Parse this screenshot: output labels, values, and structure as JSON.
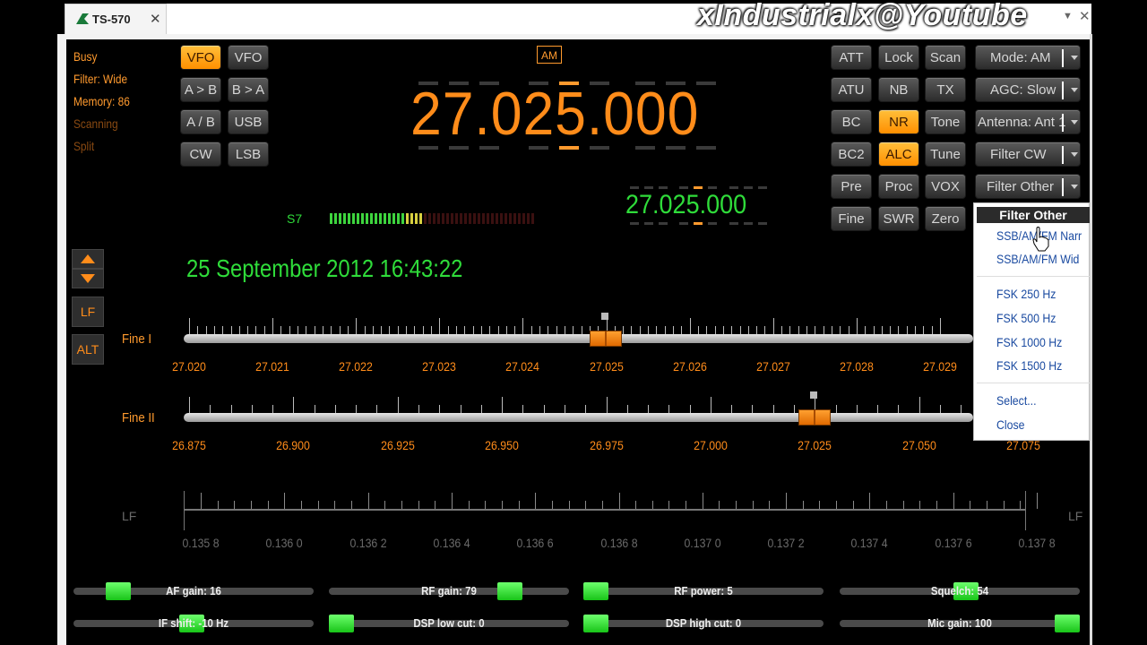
{
  "tab": {
    "title": "TS-570",
    "close": "✕"
  },
  "watermark": "xIndustrialx@Youtube",
  "window": {
    "dropdown": "▼",
    "close": "✕"
  },
  "status": {
    "busy": "Busy",
    "filter": "Filter: Wide",
    "memory": "Memory: 86",
    "scanning": "Scanning",
    "split": "Split"
  },
  "vfo_buttons": {
    "vfo_a": "VFO A",
    "vfo_b": "VFO B",
    "a_to_b": "A > B",
    "b_to_a": "B > A",
    "a_slash_b": "A / B",
    "usb": "USB",
    "cw": "CW",
    "lsb": "LSB"
  },
  "mode_badge": "AM",
  "main_frequency": "27.025.000",
  "sub_frequency": "27.025.000",
  "smeter": {
    "label": "S7",
    "level_fraction": 0.45
  },
  "clock": "25 September 2012 16:43:22",
  "right_buttons": {
    "att": "ATT",
    "lock": "Lock",
    "scan": "Scan",
    "atu": "ATU",
    "nb": "NB",
    "tx": "TX",
    "bc": "BC",
    "nr": "NR",
    "tone": "Tone",
    "bc2": "BC2",
    "alc": "ALC",
    "tune": "Tune",
    "pre": "Pre",
    "proc": "Proc",
    "vox": "VOX",
    "fine": "Fine",
    "swr": "SWR",
    "zero": "Zero"
  },
  "dropdowns": {
    "mode": "Mode: AM",
    "agc": "AGC: Slow",
    "antenna": "Antenna: Ant 1",
    "filter_cw": "Filter CW",
    "filter_other": "Filter Other"
  },
  "side_buttons": {
    "lf": "LF",
    "alt": "ALT"
  },
  "fine1": {
    "label": "Fine I",
    "ticks": [
      "27.020",
      "27.021",
      "27.022",
      "27.023",
      "27.024",
      "27.025",
      "27.026",
      "27.027",
      "27.028",
      "27.029"
    ],
    "value": "27.025"
  },
  "fine2": {
    "label": "Fine II",
    "ticks": [
      "26.875",
      "26.900",
      "26.925",
      "26.950",
      "26.975",
      "27.000",
      "27.025",
      "27.050",
      "27.075"
    ],
    "value": "27.025"
  },
  "lf_scale": {
    "left_label": "LF",
    "right_label": "LF",
    "ticks": [
      "0.135 8",
      "0.136 0",
      "0.136 2",
      "0.136 4",
      "0.136 6",
      "0.136 8",
      "0.137 0",
      "0.137 2",
      "0.137 4",
      "0.137 6",
      "0.137 8"
    ]
  },
  "filter_menu": {
    "header": "Filter Other",
    "items": [
      "SSB/AM/FM Narr",
      "SSB/AM/FM Wid",
      "FSK 250 Hz",
      "FSK 500 Hz",
      "FSK 1000 Hz",
      "FSK 1500 Hz",
      "Select...",
      "Close"
    ]
  },
  "sliders": {
    "af_gain": "AF gain: 16",
    "rf_gain": "RF gain: 79",
    "rf_power": "RF power: 5",
    "squelch": "Squelch: 54",
    "if_shift": "IF shift: -10 Hz",
    "dsp_low": "DSP low cut: 0",
    "dsp_high": "DSP high cut: 0",
    "mic_gain": "Mic gain: 100"
  },
  "colors": {
    "accent_orange": "#ff8c1a",
    "display_green": "#2fdc3a",
    "knob_green": "#18c418"
  }
}
